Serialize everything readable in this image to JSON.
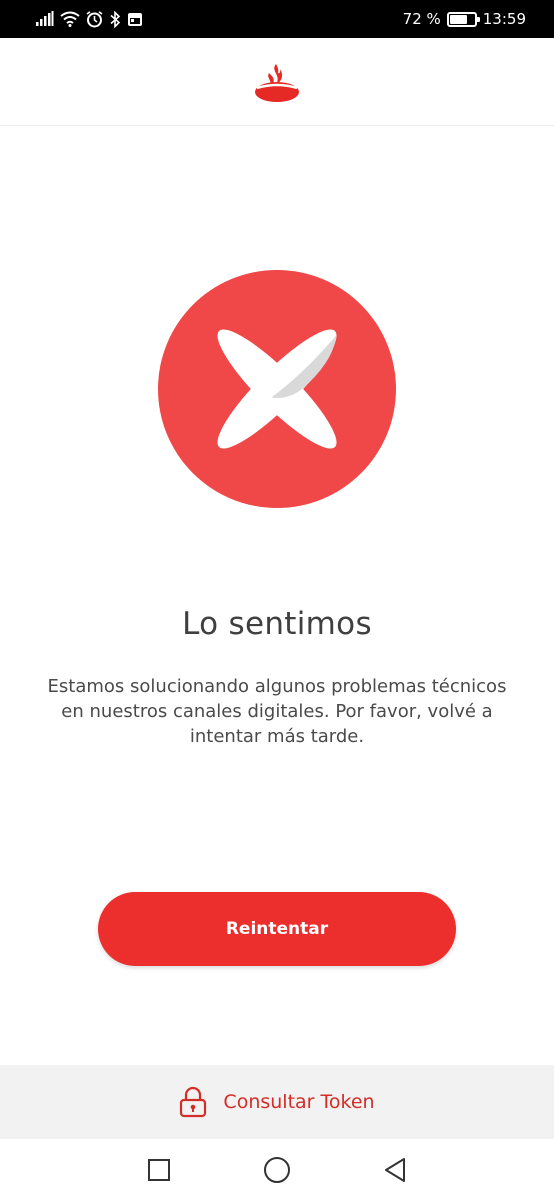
{
  "status_bar": {
    "battery_percent": "72 %",
    "time": "13:59",
    "battery_level": 0.72,
    "icons": [
      "signal-icon",
      "wifi-icon",
      "alarm-icon",
      "bluetooth-icon",
      "calendar-icon"
    ]
  },
  "header": {
    "logo": "santander-flame-icon"
  },
  "error": {
    "icon": "error-x-icon",
    "title": "Lo sentimos",
    "message": "Estamos solucionando algunos problemas técnicos en nuestros canales digitales. Por favor, volvé a intentar más tarde."
  },
  "actions": {
    "retry_label": "Reintentar"
  },
  "token": {
    "icon": "lock-icon",
    "label": "Consultar Token"
  },
  "nav": {
    "recents": "recents-square-icon",
    "home": "home-circle-icon",
    "back": "back-triangle-icon"
  },
  "colors": {
    "brand_red": "#ec2f2c",
    "circle_red": "#f04848",
    "text": "#3f3f3f"
  }
}
